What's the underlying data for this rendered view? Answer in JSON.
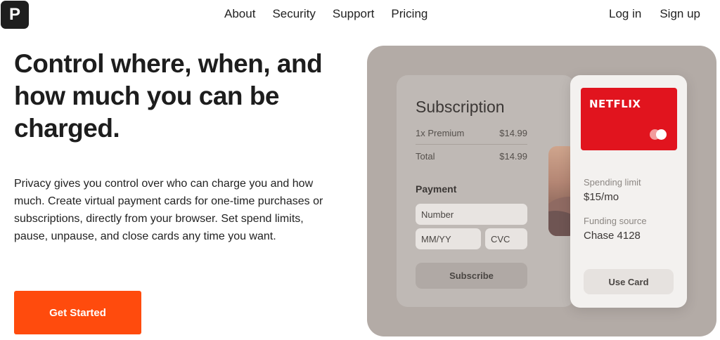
{
  "brand": {
    "logo_letter": "P"
  },
  "nav": {
    "items": [
      "About",
      "Security",
      "Support",
      "Pricing"
    ]
  },
  "auth": {
    "login": "Log in",
    "signup": "Sign up"
  },
  "hero": {
    "title": "Control where, when, and how much you can be charged.",
    "description": "Privacy gives you control over who can charge you and how much. Create virtual payment cards for one-time purchases or subscriptions, directly from your browser. Set spend limits, pause, unpause, and close cards any time you want.",
    "cta": "Get Started"
  },
  "subscription": {
    "title": "Subscription",
    "line_item": {
      "label": "1x Premium",
      "amount": "$14.99"
    },
    "total": {
      "label": "Total",
      "amount": "$14.99"
    },
    "payment_label": "Payment",
    "fields": {
      "number": "Number",
      "expiry": "MM/YY",
      "cvc": "CVC"
    },
    "button": "Subscribe"
  },
  "card": {
    "merchant": "NETFLIX",
    "spending_limit_label": "Spending limit",
    "spending_limit_value": "$15/mo",
    "funding_label": "Funding source",
    "funding_value": "Chase 4128",
    "button": "Use Card"
  },
  "colors": {
    "accent": "#ff4b0d",
    "netflix_red": "#e1141e",
    "stage": "#b3aba6"
  }
}
